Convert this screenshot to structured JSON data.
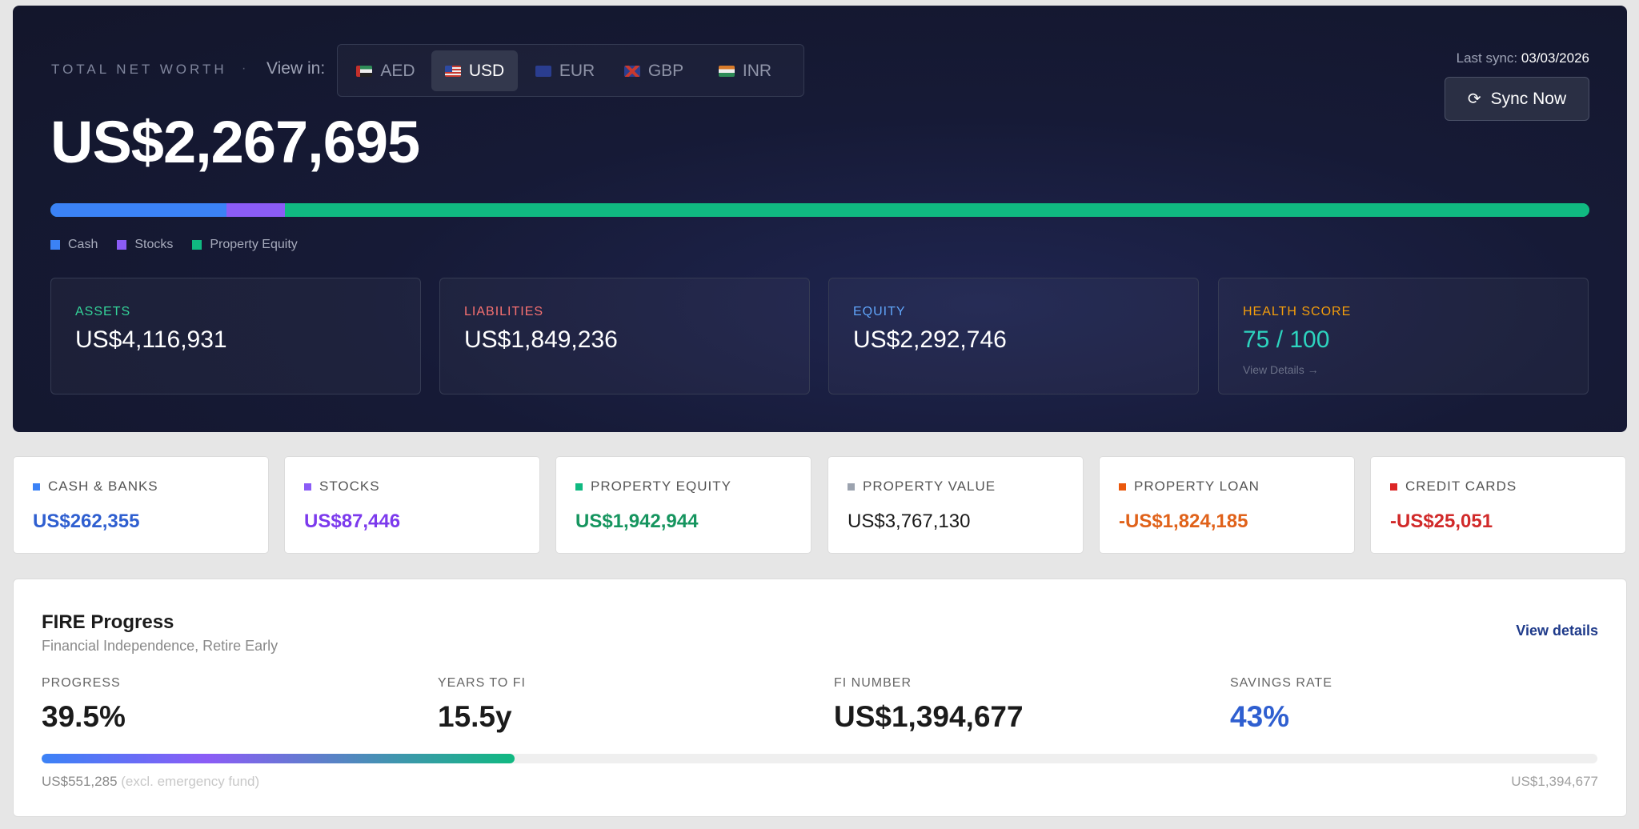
{
  "hero": {
    "label": "TOTAL NET WORTH",
    "separator": "·",
    "view_in_label": "View in:",
    "currencies": [
      {
        "code": "AED",
        "active": false
      },
      {
        "code": "USD",
        "active": true
      },
      {
        "code": "EUR",
        "active": false
      },
      {
        "code": "GBP",
        "active": false
      },
      {
        "code": "INR",
        "active": false
      }
    ],
    "total_value": "US$2,267,695",
    "last_sync_label": "Last sync:",
    "last_sync_value": "03/03/2026",
    "sync_button": "Sync Now",
    "sync_icon": "refresh-icon",
    "allocation": [
      {
        "name": "Cash",
        "color": "#3b82f6",
        "value": 262355
      },
      {
        "name": "Stocks",
        "color": "#8b5cf6",
        "value": 87446
      },
      {
        "name": "Property Equity",
        "color": "#10b981",
        "value": 1942944
      }
    ],
    "stats": [
      {
        "label": "ASSETS",
        "value": "US$4,116,931",
        "label_color": "#34d399"
      },
      {
        "label": "LIABILITIES",
        "value": "US$1,849,236",
        "label_color": "#f87171"
      },
      {
        "label": "EQUITY",
        "value": "US$2,292,746",
        "label_color": "#60a5fa"
      },
      {
        "label": "HEALTH SCORE",
        "value": "75 / 100",
        "label_color": "#f59e0b",
        "value_color": "#2dd4bf",
        "link": "View Details →"
      }
    ]
  },
  "breakdown": [
    {
      "label": "CASH & BANKS",
      "value": "US$262,355",
      "color": "#3b82f6",
      "value_color": "#2f5fd0"
    },
    {
      "label": "STOCKS",
      "value": "US$87,446",
      "color": "#8b5cf6",
      "value_color": "#7c3aed"
    },
    {
      "label": "PROPERTY EQUITY",
      "value": "US$1,942,944",
      "color": "#10b981",
      "value_color": "#16955f"
    },
    {
      "label": "PROPERTY VALUE",
      "value": "US$3,767,130",
      "color": "#9ca3af",
      "value_color": "#1b1b1b"
    },
    {
      "label": "PROPERTY LOAN",
      "value": "-US$1,824,185",
      "color": "#ea580c",
      "value_color": "#e0621a"
    },
    {
      "label": "CREDIT CARDS",
      "value": "-US$25,051",
      "color": "#dc2626",
      "value_color": "#d12a2a"
    }
  ],
  "fire": {
    "title": "FIRE Progress",
    "subtitle": "Financial Independence, Retire Early",
    "view_details": "View details",
    "metrics": [
      {
        "label": "PROGRESS",
        "value": "39.5%",
        "color": "#1b1b1b"
      },
      {
        "label": "YEARS TO FI",
        "value": "15.5y",
        "color": "#1b1b1b"
      },
      {
        "label": "FI NUMBER",
        "value": "US$1,394,677",
        "color": "#1b1b1b"
      },
      {
        "label": "SAVINGS RATE",
        "value": "43%",
        "color": "#2f5fd0"
      }
    ],
    "progress_fraction": 0.395,
    "current_value": "US$551,285",
    "current_note": "(excl. emergency fund)",
    "target_value": "US$1,394,677"
  }
}
